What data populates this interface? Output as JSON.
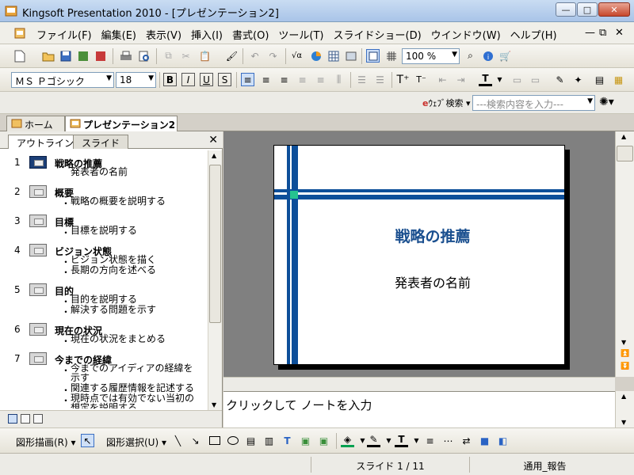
{
  "window": {
    "title": "Kingsoft Presentation 2010 - [プレゼンテーション2]",
    "minimize": "—",
    "maximize": "□",
    "close": "✕"
  },
  "menu": {
    "items": [
      "ファイル(F)",
      "編集(E)",
      "表示(V)",
      "挿入(I)",
      "書式(O)",
      "ツール(T)",
      "スライドショー(D)",
      "ウインドウ(W)",
      "ヘルプ(H)"
    ],
    "mdi_minimize": "—",
    "mdi_restore": "⧉",
    "mdi_close": "✕"
  },
  "toolbar": {
    "zoom": "100 %"
  },
  "format_bar": {
    "font": "ＭＳ Ｐゴシック",
    "size": "18"
  },
  "search": {
    "engine_label": "ｳｪﾌﾞ検索",
    "placeholder": "---検索内容を入力---"
  },
  "doc_tabs": {
    "home": "ホーム",
    "document": "プレゼンテーション2"
  },
  "pane": {
    "tab_outline": "アウトライン",
    "tab_slides": "スライド",
    "close": "✕"
  },
  "outline": [
    {
      "num": "1",
      "title": "戦略の推薦",
      "lines": [
        {
          "bullet": "",
          "text": "発表者の名前"
        }
      ]
    },
    {
      "num": "2",
      "title": "概要",
      "lines": [
        {
          "bullet": "・",
          "text": "戦略の概要を説明する"
        }
      ]
    },
    {
      "num": "3",
      "title": "目標",
      "lines": [
        {
          "bullet": "・",
          "text": "目標を説明する"
        }
      ]
    },
    {
      "num": "4",
      "title": "ビジョン状態",
      "lines": [
        {
          "bullet": "・",
          "text": "ビジョン状態を描く"
        },
        {
          "bullet": "・",
          "text": "長期の方向を述べる"
        }
      ]
    },
    {
      "num": "5",
      "title": "目的",
      "lines": [
        {
          "bullet": "・",
          "text": "目的を説明する"
        },
        {
          "bullet": "・",
          "text": "解決する問題を示す"
        }
      ]
    },
    {
      "num": "6",
      "title": "現在の状況",
      "lines": [
        {
          "bullet": "・",
          "text": "現在の状況をまとめる"
        }
      ]
    },
    {
      "num": "7",
      "title": "今までの経緯",
      "lines": [
        {
          "bullet": "・",
          "text": "今までのアイディアの経緯を示す"
        },
        {
          "bullet": "・",
          "text": "関連する履歴情報を記述する"
        },
        {
          "bullet": "・",
          "text": "現時点では有効でない当初の想定を説明する"
        }
      ]
    }
  ],
  "slide": {
    "title": "戦略の推薦",
    "subtitle": "発表者の名前",
    "title_color": "#1a4f8f"
  },
  "notes": {
    "placeholder": "クリックして ノートを入力"
  },
  "drawbar": {
    "draw_label": "図形描画(R)",
    "select_label": "図形選択(U)"
  },
  "status": {
    "slide_pos": "スライド 1 / 11",
    "template": "通用_報告"
  }
}
